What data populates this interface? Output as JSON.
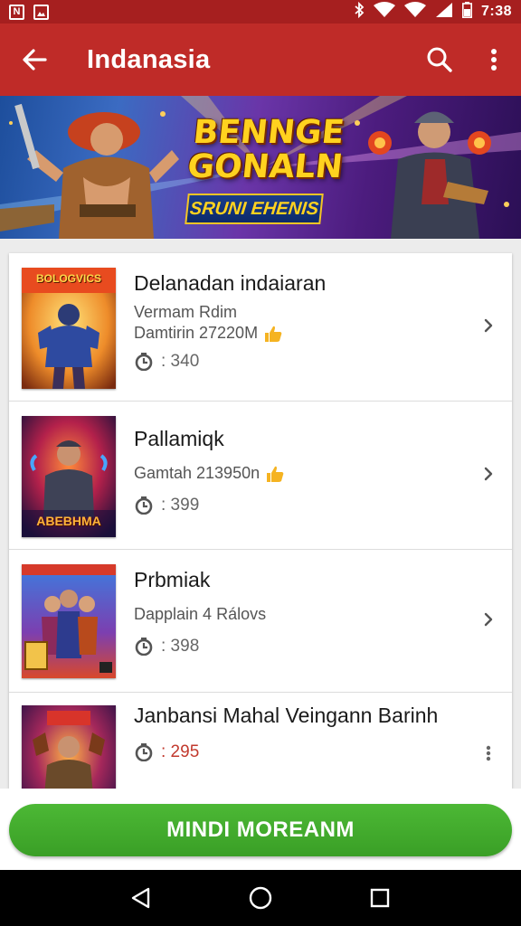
{
  "status_bar": {
    "time": "7:38",
    "left_icons": [
      "N",
      "image-icon"
    ],
    "right_icons": [
      "bluetooth-icon",
      "wifi-icon",
      "signal-icon",
      "battery-icon"
    ]
  },
  "app_bar": {
    "title": "Indanasia",
    "back_icon": "arrow-left-icon",
    "search_icon": "search-icon",
    "more_icon": "more-vert-icon"
  },
  "banner": {
    "title": "BENNGE GONALN",
    "subtitle": "SRUNI EHENIS"
  },
  "list": {
    "items": [
      {
        "title": "Delanadan indaiaran",
        "line1": "Vermam Rdim",
        "line2": "Damtirin 27220M",
        "meta_value": ": 340",
        "thumb_label": "BOLOGVICS",
        "trailing": "chevron-right-icon"
      },
      {
        "title": "Pallamiqk",
        "line2": "Gamtah 213950n",
        "meta_value": ": 399",
        "thumb_label": "ABEBHMA",
        "trailing": "chevron-right-icon"
      },
      {
        "title": "Prbmiak",
        "line2": "Dapplain 4 Rálovs",
        "meta_value": ": 398",
        "thumb_label": "",
        "trailing": "chevron-right-icon"
      },
      {
        "title": "Janbansi Mahal Veingann Barinh",
        "meta_value": ": 295",
        "thumb_label": "",
        "trailing": "more-vert-icon"
      }
    ]
  },
  "cta_button": {
    "label": "MINDI MOREANM"
  },
  "nav_bar": {
    "back_icon": "triangle-back-icon",
    "home_icon": "circle-home-icon",
    "recents_icon": "square-recents-icon"
  },
  "colors": {
    "status_bar": "#a61f1f",
    "app_bar": "#bf2b28",
    "cta": "#43ab2d"
  }
}
